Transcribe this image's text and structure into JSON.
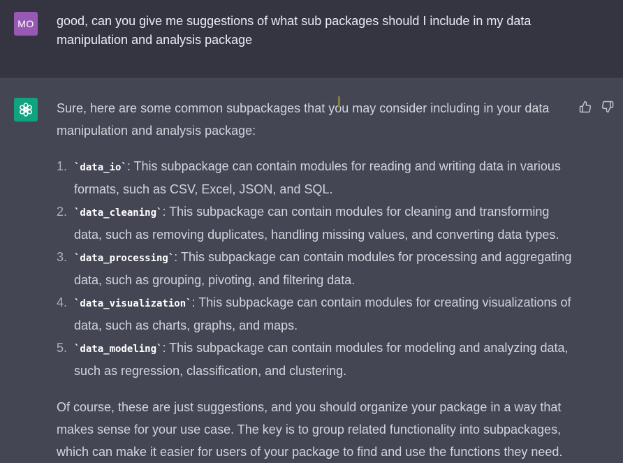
{
  "user_message": {
    "avatar_initials": "MO",
    "text": "good, can you give me suggestions of what sub packages should I include in my data manipulation and analysis package"
  },
  "assistant_message": {
    "intro": "Sure, here are some common subpackages that you may consider including in your data manipulation and analysis package:",
    "items": [
      {
        "num": "1.",
        "code": "`data_io`",
        "text": ": This subpackage can contain modules for reading and writing data in various formats, such as CSV, Excel, JSON, and SQL."
      },
      {
        "num": "2.",
        "code": "`data_cleaning`",
        "text": ": This subpackage can contain modules for cleaning and transforming data, such as removing duplicates, handling missing values, and converting data types."
      },
      {
        "num": "3.",
        "code": "`data_processing`",
        "text": ": This subpackage can contain modules for processing and aggregating data, such as grouping, pivoting, and filtering data."
      },
      {
        "num": "4.",
        "code": "`data_visualization`",
        "text": ": This subpackage can contain modules for creating visualizations of data, such as charts, graphs, and maps."
      },
      {
        "num": "5.",
        "code": "`data_modeling`",
        "text": ": This subpackage can contain modules for modeling and analyzing data, such as regression, classification, and clustering."
      }
    ],
    "outro": "Of course, these are just suggestions, and you should organize your package in a way that makes sense for your use case. The key is to group related functionality into subpackages, which can make it easier for users of your package to find and use the functions they need."
  },
  "icons": {
    "assistant_avatar": "openai-logo-icon",
    "thumbs_up": "thumbs-up-icon",
    "thumbs_down": "thumbs-down-icon"
  },
  "colors": {
    "user_bg": "#343541",
    "assistant_bg": "#444654",
    "user_avatar_bg": "#9859b4",
    "assistant_avatar_bg": "#10a37f"
  }
}
